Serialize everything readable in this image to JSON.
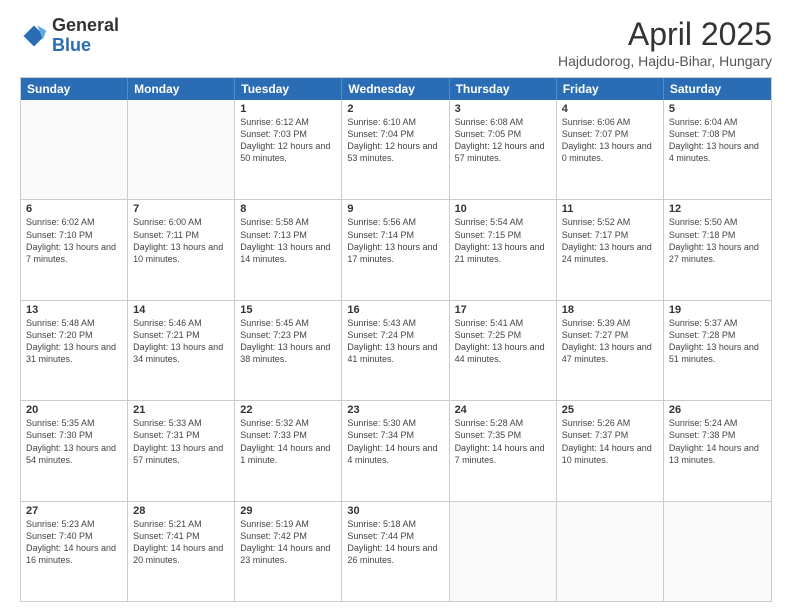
{
  "header": {
    "logo_general": "General",
    "logo_blue": "Blue",
    "title": "April 2025",
    "location": "Hajdudorog, Hajdu-Bihar, Hungary"
  },
  "calendar": {
    "weekdays": [
      "Sunday",
      "Monday",
      "Tuesday",
      "Wednesday",
      "Thursday",
      "Friday",
      "Saturday"
    ],
    "rows": [
      [
        {
          "day": "",
          "sunrise": "",
          "sunset": "",
          "daylight": ""
        },
        {
          "day": "",
          "sunrise": "",
          "sunset": "",
          "daylight": ""
        },
        {
          "day": "1",
          "sunrise": "Sunrise: 6:12 AM",
          "sunset": "Sunset: 7:03 PM",
          "daylight": "Daylight: 12 hours and 50 minutes."
        },
        {
          "day": "2",
          "sunrise": "Sunrise: 6:10 AM",
          "sunset": "Sunset: 7:04 PM",
          "daylight": "Daylight: 12 hours and 53 minutes."
        },
        {
          "day": "3",
          "sunrise": "Sunrise: 6:08 AM",
          "sunset": "Sunset: 7:05 PM",
          "daylight": "Daylight: 12 hours and 57 minutes."
        },
        {
          "day": "4",
          "sunrise": "Sunrise: 6:06 AM",
          "sunset": "Sunset: 7:07 PM",
          "daylight": "Daylight: 13 hours and 0 minutes."
        },
        {
          "day": "5",
          "sunrise": "Sunrise: 6:04 AM",
          "sunset": "Sunset: 7:08 PM",
          "daylight": "Daylight: 13 hours and 4 minutes."
        }
      ],
      [
        {
          "day": "6",
          "sunrise": "Sunrise: 6:02 AM",
          "sunset": "Sunset: 7:10 PM",
          "daylight": "Daylight: 13 hours and 7 minutes."
        },
        {
          "day": "7",
          "sunrise": "Sunrise: 6:00 AM",
          "sunset": "Sunset: 7:11 PM",
          "daylight": "Daylight: 13 hours and 10 minutes."
        },
        {
          "day": "8",
          "sunrise": "Sunrise: 5:58 AM",
          "sunset": "Sunset: 7:13 PM",
          "daylight": "Daylight: 13 hours and 14 minutes."
        },
        {
          "day": "9",
          "sunrise": "Sunrise: 5:56 AM",
          "sunset": "Sunset: 7:14 PM",
          "daylight": "Daylight: 13 hours and 17 minutes."
        },
        {
          "day": "10",
          "sunrise": "Sunrise: 5:54 AM",
          "sunset": "Sunset: 7:15 PM",
          "daylight": "Daylight: 13 hours and 21 minutes."
        },
        {
          "day": "11",
          "sunrise": "Sunrise: 5:52 AM",
          "sunset": "Sunset: 7:17 PM",
          "daylight": "Daylight: 13 hours and 24 minutes."
        },
        {
          "day": "12",
          "sunrise": "Sunrise: 5:50 AM",
          "sunset": "Sunset: 7:18 PM",
          "daylight": "Daylight: 13 hours and 27 minutes."
        }
      ],
      [
        {
          "day": "13",
          "sunrise": "Sunrise: 5:48 AM",
          "sunset": "Sunset: 7:20 PM",
          "daylight": "Daylight: 13 hours and 31 minutes."
        },
        {
          "day": "14",
          "sunrise": "Sunrise: 5:46 AM",
          "sunset": "Sunset: 7:21 PM",
          "daylight": "Daylight: 13 hours and 34 minutes."
        },
        {
          "day": "15",
          "sunrise": "Sunrise: 5:45 AM",
          "sunset": "Sunset: 7:23 PM",
          "daylight": "Daylight: 13 hours and 38 minutes."
        },
        {
          "day": "16",
          "sunrise": "Sunrise: 5:43 AM",
          "sunset": "Sunset: 7:24 PM",
          "daylight": "Daylight: 13 hours and 41 minutes."
        },
        {
          "day": "17",
          "sunrise": "Sunrise: 5:41 AM",
          "sunset": "Sunset: 7:25 PM",
          "daylight": "Daylight: 13 hours and 44 minutes."
        },
        {
          "day": "18",
          "sunrise": "Sunrise: 5:39 AM",
          "sunset": "Sunset: 7:27 PM",
          "daylight": "Daylight: 13 hours and 47 minutes."
        },
        {
          "day": "19",
          "sunrise": "Sunrise: 5:37 AM",
          "sunset": "Sunset: 7:28 PM",
          "daylight": "Daylight: 13 hours and 51 minutes."
        }
      ],
      [
        {
          "day": "20",
          "sunrise": "Sunrise: 5:35 AM",
          "sunset": "Sunset: 7:30 PM",
          "daylight": "Daylight: 13 hours and 54 minutes."
        },
        {
          "day": "21",
          "sunrise": "Sunrise: 5:33 AM",
          "sunset": "Sunset: 7:31 PM",
          "daylight": "Daylight: 13 hours and 57 minutes."
        },
        {
          "day": "22",
          "sunrise": "Sunrise: 5:32 AM",
          "sunset": "Sunset: 7:33 PM",
          "daylight": "Daylight: 14 hours and 1 minute."
        },
        {
          "day": "23",
          "sunrise": "Sunrise: 5:30 AM",
          "sunset": "Sunset: 7:34 PM",
          "daylight": "Daylight: 14 hours and 4 minutes."
        },
        {
          "day": "24",
          "sunrise": "Sunrise: 5:28 AM",
          "sunset": "Sunset: 7:35 PM",
          "daylight": "Daylight: 14 hours and 7 minutes."
        },
        {
          "day": "25",
          "sunrise": "Sunrise: 5:26 AM",
          "sunset": "Sunset: 7:37 PM",
          "daylight": "Daylight: 14 hours and 10 minutes."
        },
        {
          "day": "26",
          "sunrise": "Sunrise: 5:24 AM",
          "sunset": "Sunset: 7:38 PM",
          "daylight": "Daylight: 14 hours and 13 minutes."
        }
      ],
      [
        {
          "day": "27",
          "sunrise": "Sunrise: 5:23 AM",
          "sunset": "Sunset: 7:40 PM",
          "daylight": "Daylight: 14 hours and 16 minutes."
        },
        {
          "day": "28",
          "sunrise": "Sunrise: 5:21 AM",
          "sunset": "Sunset: 7:41 PM",
          "daylight": "Daylight: 14 hours and 20 minutes."
        },
        {
          "day": "29",
          "sunrise": "Sunrise: 5:19 AM",
          "sunset": "Sunset: 7:42 PM",
          "daylight": "Daylight: 14 hours and 23 minutes."
        },
        {
          "day": "30",
          "sunrise": "Sunrise: 5:18 AM",
          "sunset": "Sunset: 7:44 PM",
          "daylight": "Daylight: 14 hours and 26 minutes."
        },
        {
          "day": "",
          "sunrise": "",
          "sunset": "",
          "daylight": ""
        },
        {
          "day": "",
          "sunrise": "",
          "sunset": "",
          "daylight": ""
        },
        {
          "day": "",
          "sunrise": "",
          "sunset": "",
          "daylight": ""
        }
      ]
    ]
  }
}
